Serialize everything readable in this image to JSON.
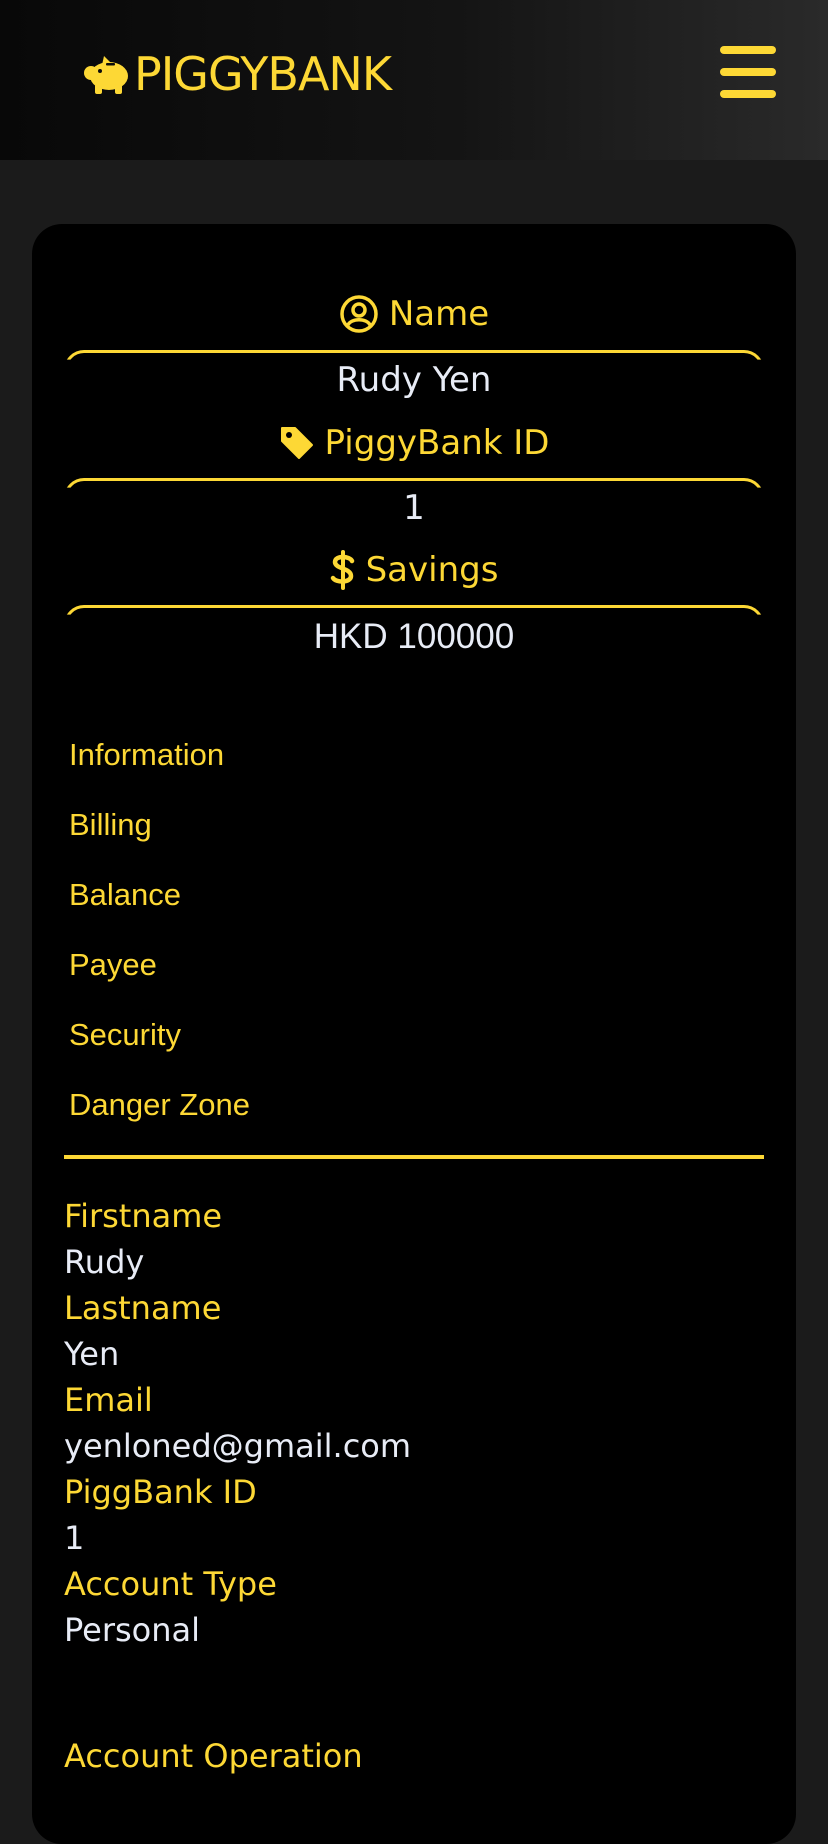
{
  "header": {
    "brand": "PIGGYBANK",
    "logo_icon": "piggy-icon",
    "menu_icon": "hamburger-menu-icon"
  },
  "colors": {
    "accent": "#fdd835",
    "background": "#1b1b1b",
    "card": "#000000",
    "value_text": "#e8ecf6"
  },
  "summary": {
    "name_label": "Name",
    "name_icon": "user-circle-icon",
    "name_value": "Rudy Yen",
    "id_label": "PiggyBank ID",
    "id_icon": "tag-icon",
    "id_value": "1",
    "savings_label": "Savings",
    "savings_icon": "dollar-icon",
    "savings_value": "HKD 100000"
  },
  "nav": {
    "items": [
      {
        "label": "Information"
      },
      {
        "label": "Billing"
      },
      {
        "label": "Balance"
      },
      {
        "label": "Payee"
      },
      {
        "label": "Security"
      },
      {
        "label": "Danger Zone"
      }
    ]
  },
  "details": {
    "firstname_label": "Firstname",
    "firstname_value": "Rudy",
    "lastname_label": "Lastname",
    "lastname_value": "Yen",
    "email_label": "Email",
    "email_value": "yenloned@gmail.com",
    "id_label": "PiggBank ID",
    "id_value": "1",
    "account_type_label": "Account Type",
    "account_type_value": "Personal",
    "operation_label": "Account Operation"
  }
}
